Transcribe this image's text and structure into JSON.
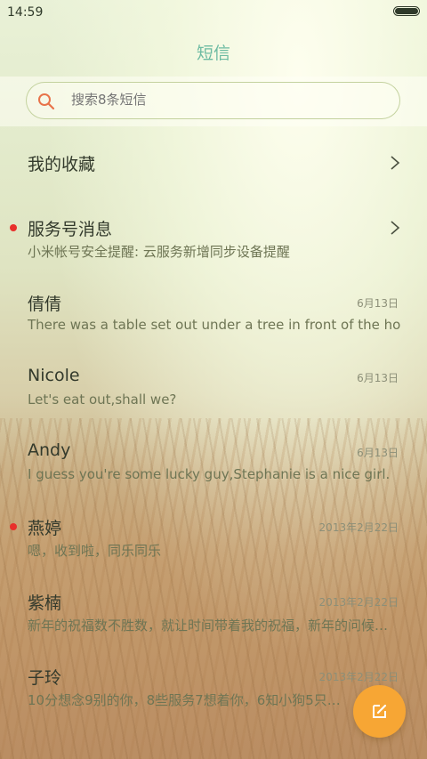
{
  "status_bar": {
    "time": "14:59",
    "battery_level": 1.0
  },
  "header": {
    "title": "短信"
  },
  "search": {
    "placeholder": "搜索8条短信"
  },
  "conversations": [
    {
      "name": "我的收藏",
      "preview": "",
      "date": "",
      "unread": false,
      "chevron": true
    },
    {
      "name": "服务号消息",
      "preview": "小米帐号安全提醒: 云服务新增同步设备提醒",
      "date": "",
      "unread": true,
      "chevron": true
    },
    {
      "name": "倩倩",
      "preview": "There was a table set out under a tree in front of the ho…",
      "date": "6月13日",
      "unread": false,
      "chevron": false
    },
    {
      "name": "Nicole",
      "preview": "Let's eat out,shall we?",
      "date": "6月13日",
      "unread": false,
      "chevron": false
    },
    {
      "name": "Andy",
      "preview": "I guess you're some lucky guy,Stephanie is a nice girl.",
      "date": "6月13日",
      "unread": false,
      "chevron": false
    },
    {
      "name": "燕婷",
      "preview": "嗯，收到啦，同乐同乐",
      "date": "2013年2月22日",
      "unread": true,
      "chevron": false
    },
    {
      "name": "紫楠",
      "preview": "新年的祝福数不胜数，就让时间带着我的祝福，新年的问候…",
      "date": "2013年2月22日",
      "unread": false,
      "chevron": false
    },
    {
      "name": "子玲",
      "preview": "10分想念9别的你，8些服务7想着你，6知小狗5只…",
      "date": "2013年2月22日",
      "unread": false,
      "chevron": false
    }
  ],
  "fab": {
    "icon": "compose-icon",
    "color": "#f7a634"
  },
  "colors": {
    "accent": "#6dbba2",
    "unread_dot": "#e8302b"
  }
}
